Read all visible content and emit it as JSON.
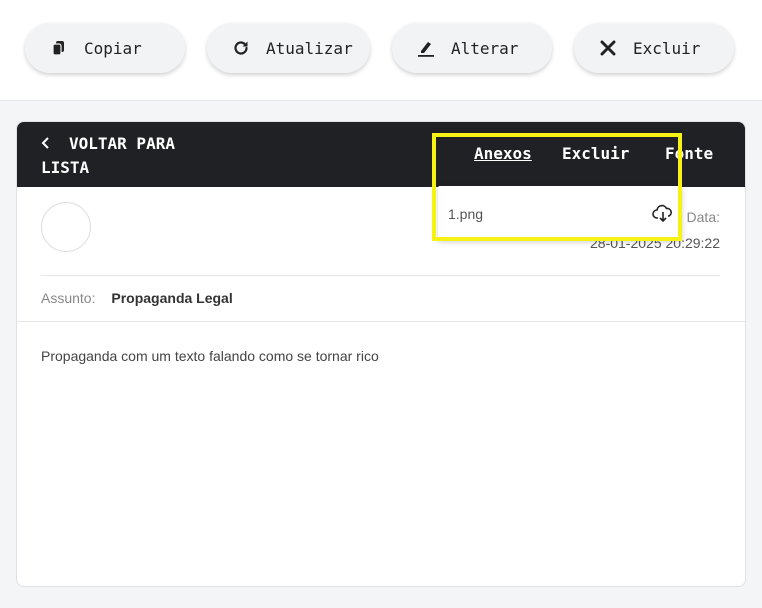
{
  "toolbar": {
    "copy_label": "Copiar",
    "refresh_label": "Atualizar",
    "edit_label": "Alterar",
    "delete_label": "Excluir"
  },
  "header": {
    "back_line1": "VOLTAR PARA",
    "back_line2": "LISTA",
    "tabs": [
      "Anexos",
      "Excluir",
      "Fonte"
    ]
  },
  "message": {
    "date_label": "Data:",
    "date_value": "28-01-2025 20:29:22",
    "subject_label": "Assunto:",
    "subject_value": "Propaganda Legal",
    "body": "Propaganda com um texto falando como se tornar rico"
  },
  "attachments": {
    "items": [
      {
        "name": "1.png",
        "icon": "cloud-download-icon"
      }
    ]
  },
  "colors": {
    "header_bg": "#1f2125",
    "highlight": "#f5f214",
    "page_bg": "#f4f5f7"
  }
}
